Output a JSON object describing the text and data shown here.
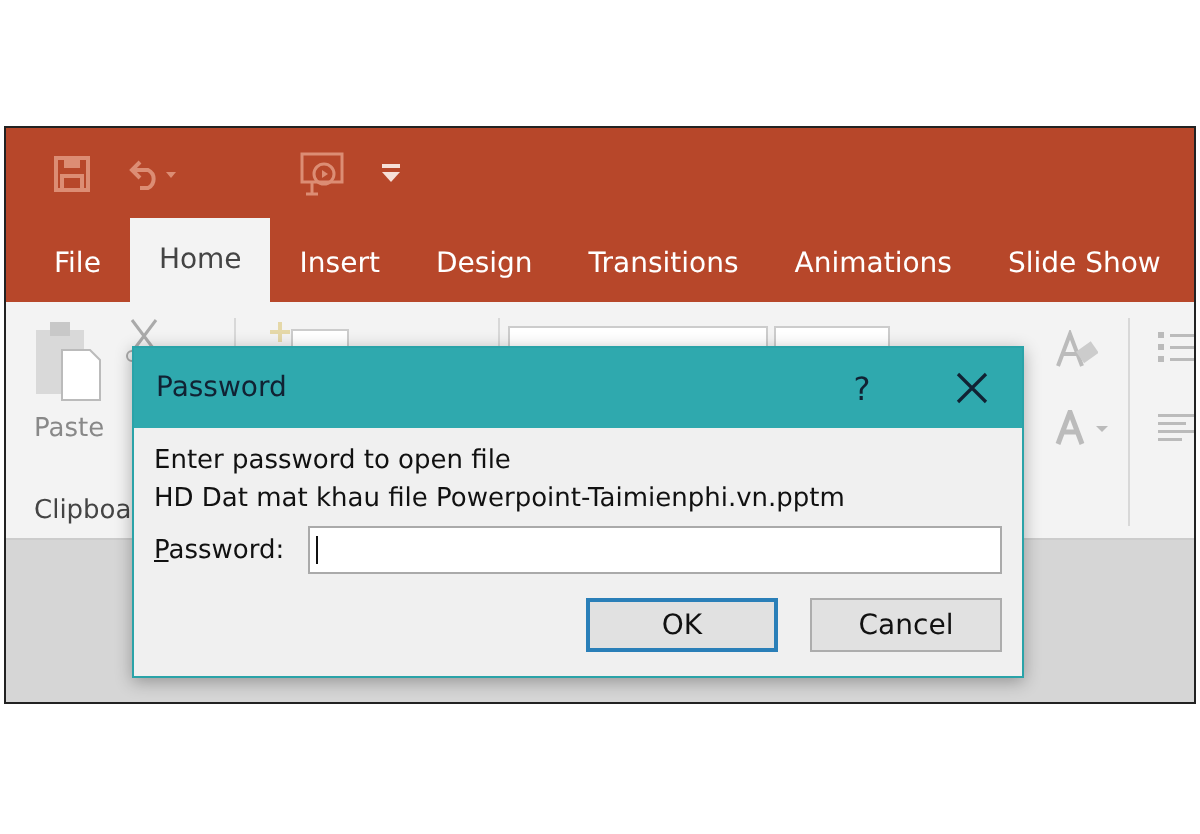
{
  "tabs": [
    {
      "label": "File",
      "selected": false
    },
    {
      "label": "Home",
      "selected": true
    },
    {
      "label": "Insert",
      "selected": false
    },
    {
      "label": "Design",
      "selected": false
    },
    {
      "label": "Transitions",
      "selected": false
    },
    {
      "label": "Animations",
      "selected": false
    },
    {
      "label": "Slide Show",
      "selected": false
    }
  ],
  "ribbon": {
    "paste_label": "Paste",
    "group_label": "Clipboa"
  },
  "dialog": {
    "title": "Password",
    "help": "?",
    "message": "Enter password to open file",
    "file_name": "HD Dat mat khau file Powerpoint-Taimienphi.vn.pptm",
    "field_label": "Password:",
    "buttons": [
      {
        "label": "OK",
        "focused": true
      },
      {
        "label": "Cancel",
        "focused": false
      }
    ]
  }
}
